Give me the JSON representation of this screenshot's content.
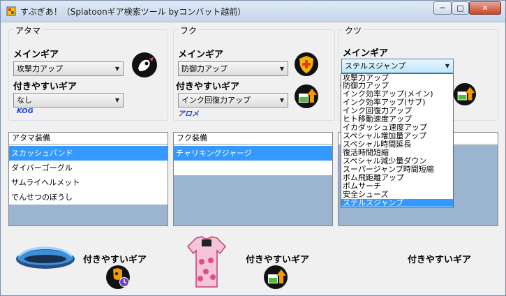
{
  "window": {
    "title": "すぷぎあ！（Splatoonギア検索ツール byコンバット越前）",
    "controls": {
      "minimize": "─",
      "maximize": "□",
      "close": "✕"
    }
  },
  "groups": {
    "head": {
      "title": "アタマ",
      "main_label": "メインギア",
      "main_value": "攻撃力アップ",
      "easy_label": "付きやすいギア",
      "easy_value": "なし",
      "brand": "KOG"
    },
    "clothes": {
      "title": "フク",
      "main_label": "メインギア",
      "main_value": "防御力アップ",
      "easy_label": "付きやすいギア",
      "easy_value": "インク回復力アップ",
      "brand": "アロメ"
    },
    "shoes": {
      "title": "クツ",
      "main_label": "メインギア",
      "main_value": "ステルスジャンプ",
      "easy_label": "付"
    }
  },
  "dropdown": {
    "items": [
      "攻撃力アップ",
      "防御力アップ",
      "インク効率アップ(メイン)",
      "インク効率アップ(サブ)",
      "インク回復力アップ",
      "ヒト移動速度アップ",
      "イカダッシュ速度アップ",
      "スペシャル増加量アップ",
      "スペシャル時間延長",
      "復活時間短縮",
      "スペシャル減少量ダウン",
      "スーパージャンプ時間短縮",
      "ボム飛距離アップ",
      "ボムサーチ",
      "安全シューズ",
      "ステルスジャンプ"
    ],
    "selected_index": 15
  },
  "lists": {
    "head": {
      "header": "アタマ装備",
      "rows": [
        "スカッシュバンド",
        "ダイバーゴーグル",
        "サムライヘルメット",
        "でんせつのぼうし"
      ],
      "selected_index": 0
    },
    "clothes": {
      "header": "フク装備",
      "rows": [
        "チャリキングジャージ"
      ],
      "selected_index": 0
    },
    "shoes": {
      "header": "",
      "rows": [],
      "selected_index": -1
    }
  },
  "bottom": {
    "head_label": "付きやすいギア",
    "clothes_label": "付きやすいギア",
    "shoes_label": "付きやすいギア"
  },
  "icons": {
    "app": "app-gear-icon",
    "head_main": "attack-up-icon",
    "clothes_main": "defense-up-icon",
    "clothes_easy": "ink-recovery-icon",
    "bottom_head_easy": "special-duration-icon",
    "bottom_clothes_easy": "ink-recovery-icon"
  },
  "colors": {
    "selection": "#3399ff",
    "brand_text": "#1f43d6",
    "list_empty_fill": "#9bb5d1"
  }
}
